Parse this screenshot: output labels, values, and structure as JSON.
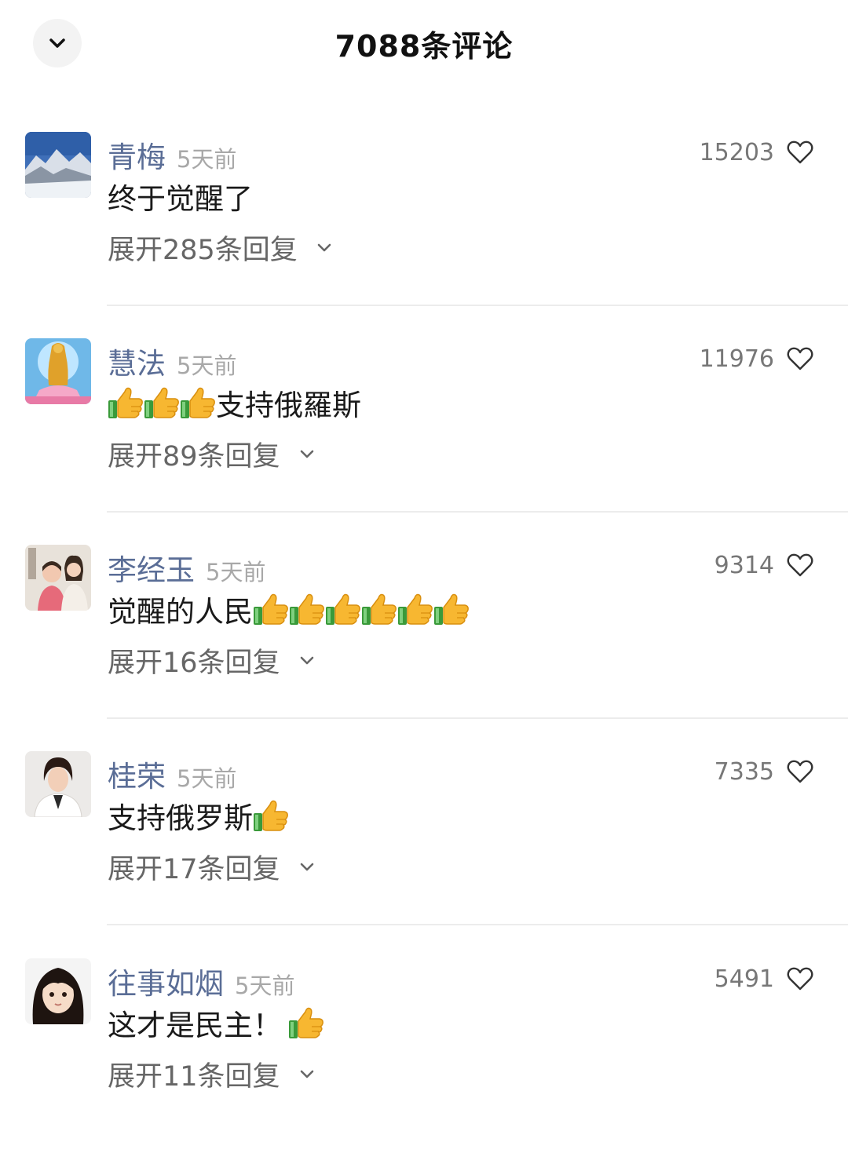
{
  "header": {
    "title": "7088条评论",
    "back_icon": "chevron-down-icon"
  },
  "comments": [
    {
      "username": "青梅",
      "time": "5天前",
      "likes": "15203",
      "content_text": "终于觉醒了",
      "thumbs_before": 0,
      "thumbs_after": 0,
      "expand": "展开285条回复",
      "avatar": "mountain-snow-photo"
    },
    {
      "username": "慧法",
      "time": "5天前",
      "likes": "11976",
      "content_text": "支持俄羅斯",
      "thumbs_before": 3,
      "thumbs_after": 0,
      "expand": "展开89条回复",
      "avatar": "golden-statue-photo"
    },
    {
      "username": "李经玉",
      "time": "5天前",
      "likes": "9314",
      "content_text": "觉醒的人民",
      "thumbs_before": 0,
      "thumbs_after": 6,
      "expand": "展开16条回复",
      "avatar": "family-photo"
    },
    {
      "username": "桂荣",
      "time": "5天前",
      "likes": "7335",
      "content_text": "支持俄罗斯",
      "thumbs_before": 0,
      "thumbs_after": 1,
      "expand": "展开17条回复",
      "avatar": "woman-portrait-photo"
    },
    {
      "username": "往事如烟",
      "time": "5天前",
      "likes": "5491",
      "content_text": "这才是民主！",
      "thumbs_before": 0,
      "thumbs_after": 1,
      "expand": "展开11条回复",
      "avatar": "girl-portrait-photo"
    }
  ],
  "colors": {
    "username": "#5a6d96",
    "time": "#a8a8a8",
    "divider": "#ececec"
  }
}
